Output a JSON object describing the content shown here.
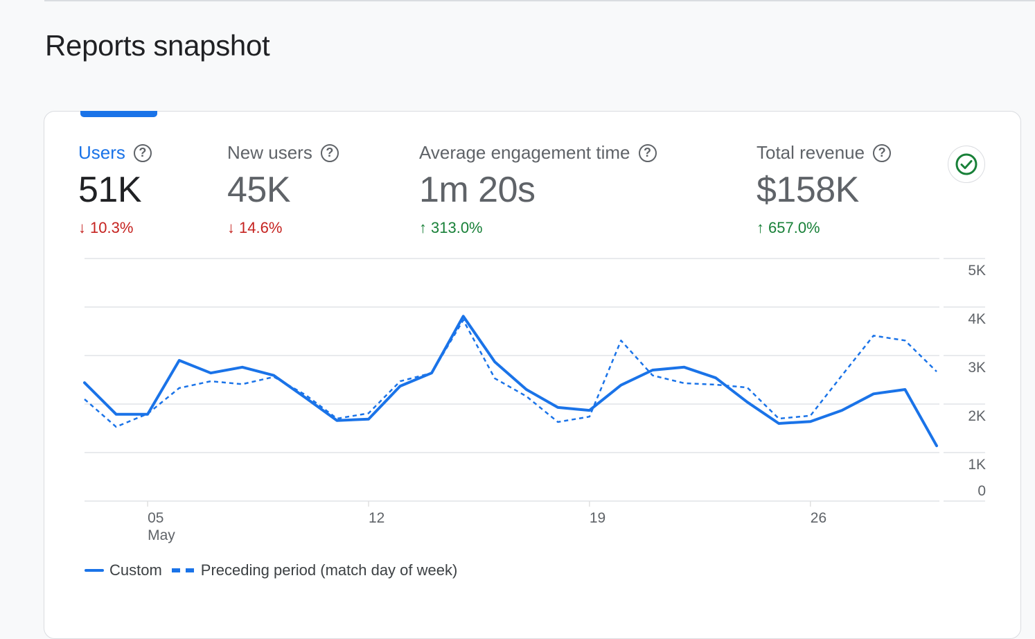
{
  "page_title": "Reports snapshot",
  "metrics": [
    {
      "label": "Users",
      "value": "51K",
      "delta": "10.3%",
      "direction": "down",
      "active": true
    },
    {
      "label": "New users",
      "value": "45K",
      "delta": "14.6%",
      "direction": "down",
      "active": false
    },
    {
      "label": "Average engagement time",
      "value": "1m 20s",
      "delta": "313.0%",
      "direction": "up",
      "active": false
    },
    {
      "label": "Total revenue",
      "value": "$158K",
      "delta": "657.0%",
      "direction": "up",
      "active": false
    }
  ],
  "icons": {
    "help": "?",
    "down_arrow": "↓",
    "up_arrow": "↑",
    "status": "check-circle-icon"
  },
  "colors": {
    "accent": "#1a73e8",
    "down": "#c5221f",
    "up": "#188038",
    "status_check": "#188038"
  },
  "chart_data": {
    "type": "line",
    "title": "",
    "xlabel": "",
    "ylabel": "",
    "x": [
      "May 03",
      "May 04",
      "May 05",
      "May 06",
      "May 07",
      "May 08",
      "May 09",
      "May 10",
      "May 11",
      "May 12",
      "May 13",
      "May 14",
      "May 15",
      "May 16",
      "May 17",
      "May 18",
      "May 19",
      "May 20",
      "May 21",
      "May 22",
      "May 23",
      "May 24",
      "May 25",
      "May 26",
      "May 27",
      "May 28",
      "May 29",
      "May 30"
    ],
    "x_ticks": [
      {
        "day": 5,
        "label": "05",
        "sublabel": "May"
      },
      {
        "day": 12,
        "label": "12",
        "sublabel": ""
      },
      {
        "day": 19,
        "label": "19",
        "sublabel": ""
      },
      {
        "day": 26,
        "label": "26",
        "sublabel": ""
      }
    ],
    "x_start_day": 3,
    "y_ticks": [
      "0",
      "1K",
      "2K",
      "3K",
      "4K",
      "5K"
    ],
    "ylim": [
      0,
      5000
    ],
    "grid": true,
    "legend_position": "bottom-left",
    "series": [
      {
        "name": "Custom",
        "style": "solid",
        "values": [
          2440,
          1790,
          1790,
          2900,
          2640,
          2760,
          2590,
          2130,
          1660,
          1690,
          2370,
          2640,
          3810,
          2870,
          2300,
          1930,
          1870,
          2390,
          2700,
          2760,
          2540,
          2040,
          1600,
          1640,
          1870,
          2210,
          2300,
          1140
        ]
      },
      {
        "name": "Preceding period (match day of week)",
        "style": "dashed",
        "values": [
          2100,
          1530,
          1800,
          2330,
          2470,
          2410,
          2560,
          2190,
          1700,
          1810,
          2470,
          2640,
          3730,
          2530,
          2160,
          1630,
          1740,
          3310,
          2590,
          2430,
          2400,
          2340,
          1700,
          1760,
          2590,
          3410,
          3310,
          2670
        ]
      }
    ]
  },
  "legend": {
    "custom": "Custom",
    "preceding": "Preceding period (match day of week)"
  }
}
